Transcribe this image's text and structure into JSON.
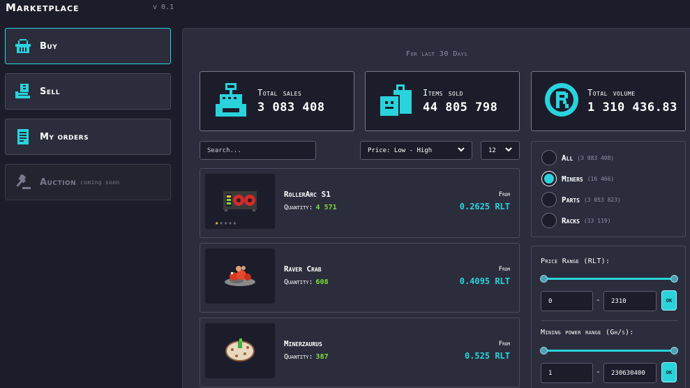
{
  "app": {
    "title": "Marketplace",
    "version": "v 0.1"
  },
  "nav": {
    "buy": "Buy",
    "sell": "Sell",
    "orders": "My orders",
    "auction": "Auction",
    "auction_note": "coming soon"
  },
  "stats": {
    "period": "For last 30 Days",
    "total_sales": {
      "label": "Total sales",
      "value": "3 083 408"
    },
    "items_sold": {
      "label": "Items sold",
      "value": "44 805 798"
    },
    "total_volume": {
      "label": "Total volume",
      "value": "1 310 436.83"
    }
  },
  "toolbar": {
    "search_placeholder": "Search...",
    "sort_value": "Price: Low - High",
    "per_page_value": "12"
  },
  "items": [
    {
      "name": "RollerArc S1",
      "qty_label": "Quantity:",
      "qty": "4 571",
      "from": "From",
      "price": "0.2625 RLT",
      "rating": 1
    },
    {
      "name": "Raver Crab",
      "qty_label": "Quantity:",
      "qty": "608",
      "from": "From",
      "price": "0.4095 RLT"
    },
    {
      "name": "Minerzaurus",
      "qty_label": "Quantity:",
      "qty": "387",
      "from": "From",
      "price": "0.525 RLT"
    }
  ],
  "filters": {
    "categories": [
      {
        "label": "All",
        "count": "(3 083 408)",
        "selected": false
      },
      {
        "label": "Miners",
        "count": "(16 466)",
        "selected": true
      },
      {
        "label": "Parts",
        "count": "(3 053 823)",
        "selected": false
      },
      {
        "label": "Racks",
        "count": "(13 119)",
        "selected": false
      }
    ],
    "price_range": {
      "label": "Price Range (RLT):",
      "min": "0",
      "max": "2310",
      "ok": "OK"
    },
    "power_range": {
      "label": "Mining power range (Gh/s):",
      "min": "1",
      "max": "230630400",
      "ok": "OK"
    },
    "dash": "-"
  },
  "colors": {
    "accent": "#2ad3dc",
    "quantity": "#7ddc3a",
    "background": "#1c1d2b",
    "panel": "#2b2d3c"
  }
}
